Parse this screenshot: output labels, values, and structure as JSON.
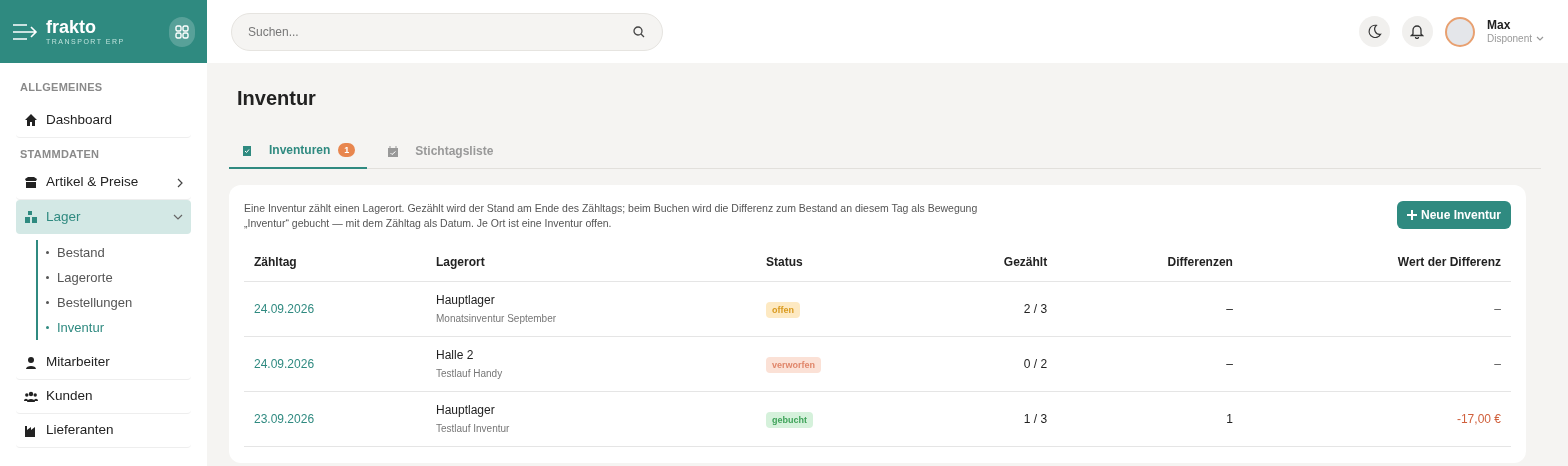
{
  "brand": {
    "name": "frakto",
    "tagline": "TRANSPORT ERP"
  },
  "search": {
    "placeholder": "Suchen..."
  },
  "user": {
    "name": "Max",
    "role": "Disponent"
  },
  "sidebar": {
    "sections": [
      {
        "title": "ALLGEMEINES",
        "items": [
          {
            "label": "Dashboard",
            "kind": "link",
            "selected": false
          }
        ]
      },
      {
        "title": "STAMMDATEN",
        "items": [
          {
            "label": "Artikel & Preise",
            "kind": "group",
            "expanded": false,
            "selected": false
          },
          {
            "label": "Lager",
            "kind": "group",
            "expanded": true,
            "selected": true,
            "children": [
              {
                "label": "Bestand",
                "selected": false
              },
              {
                "label": "Lagerorte",
                "selected": false
              },
              {
                "label": "Bestellungen",
                "selected": false
              },
              {
                "label": "Inventur",
                "selected": true
              }
            ]
          },
          {
            "label": "Mitarbeiter",
            "kind": "link",
            "selected": false
          },
          {
            "label": "Kunden",
            "kind": "link",
            "selected": false
          },
          {
            "label": "Lieferanten",
            "kind": "link",
            "selected": false
          }
        ]
      }
    ]
  },
  "page": {
    "title": "Inventur"
  },
  "tabs": [
    {
      "label": "Inventuren",
      "badge": "1",
      "selected": true
    },
    {
      "label": "Stichtagsliste",
      "selected": false
    }
  ],
  "intro": "Eine Inventur zählt einen Lagerort. Gezählt wird der Stand am Ende des Zähltags; beim Buchen wird die Differenz zum Bestand an diesem Tag als Bewegung „Inventur“ gebucht — mit dem Zähltag als Datum. Je Ort ist eine Inventur offen.",
  "new_button": "Neue Inventur",
  "table": {
    "columns": [
      "Zähltag",
      "Lagerort",
      "Status",
      "Gezählt",
      "Differenzen",
      "Wert der Differenz"
    ],
    "rows": [
      {
        "date": "24.09.2026",
        "location": "Hauptlager",
        "note": "Monatsinventur September",
        "status": {
          "label": "offen",
          "kind": "open"
        },
        "counted": "2 / 3",
        "differences": "–",
        "value": "–",
        "negative": false
      },
      {
        "date": "24.09.2026",
        "location": "Halle 2",
        "note": "Testlauf Handy",
        "status": {
          "label": "verworfen",
          "kind": "discarded"
        },
        "counted": "0 / 2",
        "differences": "–",
        "value": "–",
        "negative": false
      },
      {
        "date": "23.09.2026",
        "location": "Hauptlager",
        "note": "Testlauf Inventur",
        "status": {
          "label": "gebucht",
          "kind": "booked"
        },
        "counted": "1 / 3",
        "differences": "1",
        "value": "-17,00 €",
        "negative": true
      }
    ]
  }
}
